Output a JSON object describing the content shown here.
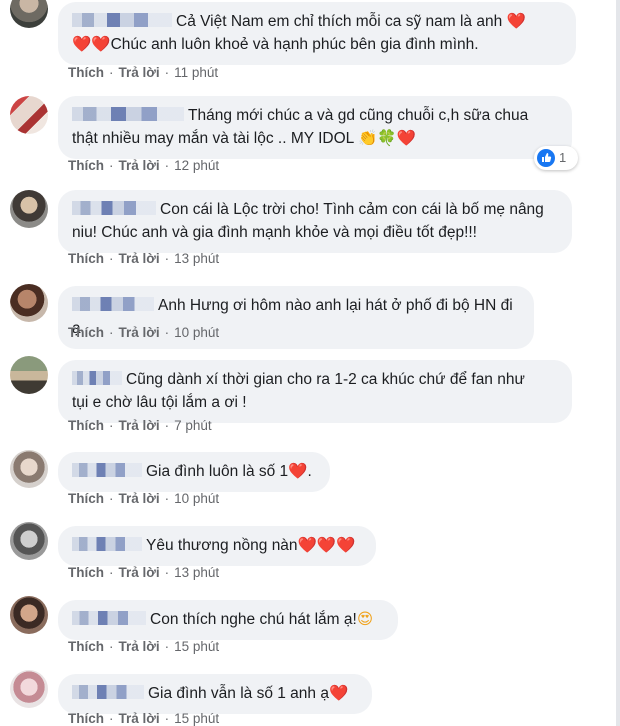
{
  "actions": {
    "like": "Thích",
    "reply": "Trả lời",
    "separator": "·"
  },
  "comments": [
    {
      "text": "Cả Việt Nam em chỉ thích mỗi ca sỹ nam là anh",
      "text2": "Chúc anh luôn khoẻ và hạnh phúc bên gia đình mình.",
      "emoji_a": "❤️",
      "emoji_b": "❤️❤️",
      "time": "11 phút"
    },
    {
      "text": "Tháng mới chúc a và gd cũng chuỗi c,h sữa chua",
      "text2": "thật nhiều may mắn và tài lộc .. MY IDOL",
      "emoji": "👏🍀❤️",
      "time": "12 phút",
      "reaction_count": "1",
      "reaction_icon": "thumbs-up-icon"
    },
    {
      "text": "Con cái là Lộc trời cho! Tình cảm con cái là bố mẹ nâng",
      "text2": "niu! Chúc anh và gia đình mạnh khỏe và mọi điều tốt đẹp!!!",
      "time": "13 phút"
    },
    {
      "text": "Anh Hưng ơi hôm nào anh lại hát ở phố đi bộ HN đi ạ",
      "time": "10 phút"
    },
    {
      "text": "Cũng dành xí thời gian cho ra 1-2 ca khúc chứ để fan như",
      "text2": "tụi e chờ lâu tội lắm a ơi !",
      "time": "7 phút"
    },
    {
      "text": "Gia đình luôn là số 1",
      "emoji": "❤️",
      "suffix": ".",
      "time": "10 phút"
    },
    {
      "text": "Yêu thương nồng nàn",
      "emoji": "❤️❤️❤️",
      "time": "13 phút"
    },
    {
      "text": "Con thích nghe chú hát lắm ạ!",
      "emoji": "😍",
      "time": "15 phút"
    },
    {
      "text": "Gia đình vẫn là số 1 anh ạ",
      "emoji": "❤️",
      "time": "15 phút"
    }
  ]
}
